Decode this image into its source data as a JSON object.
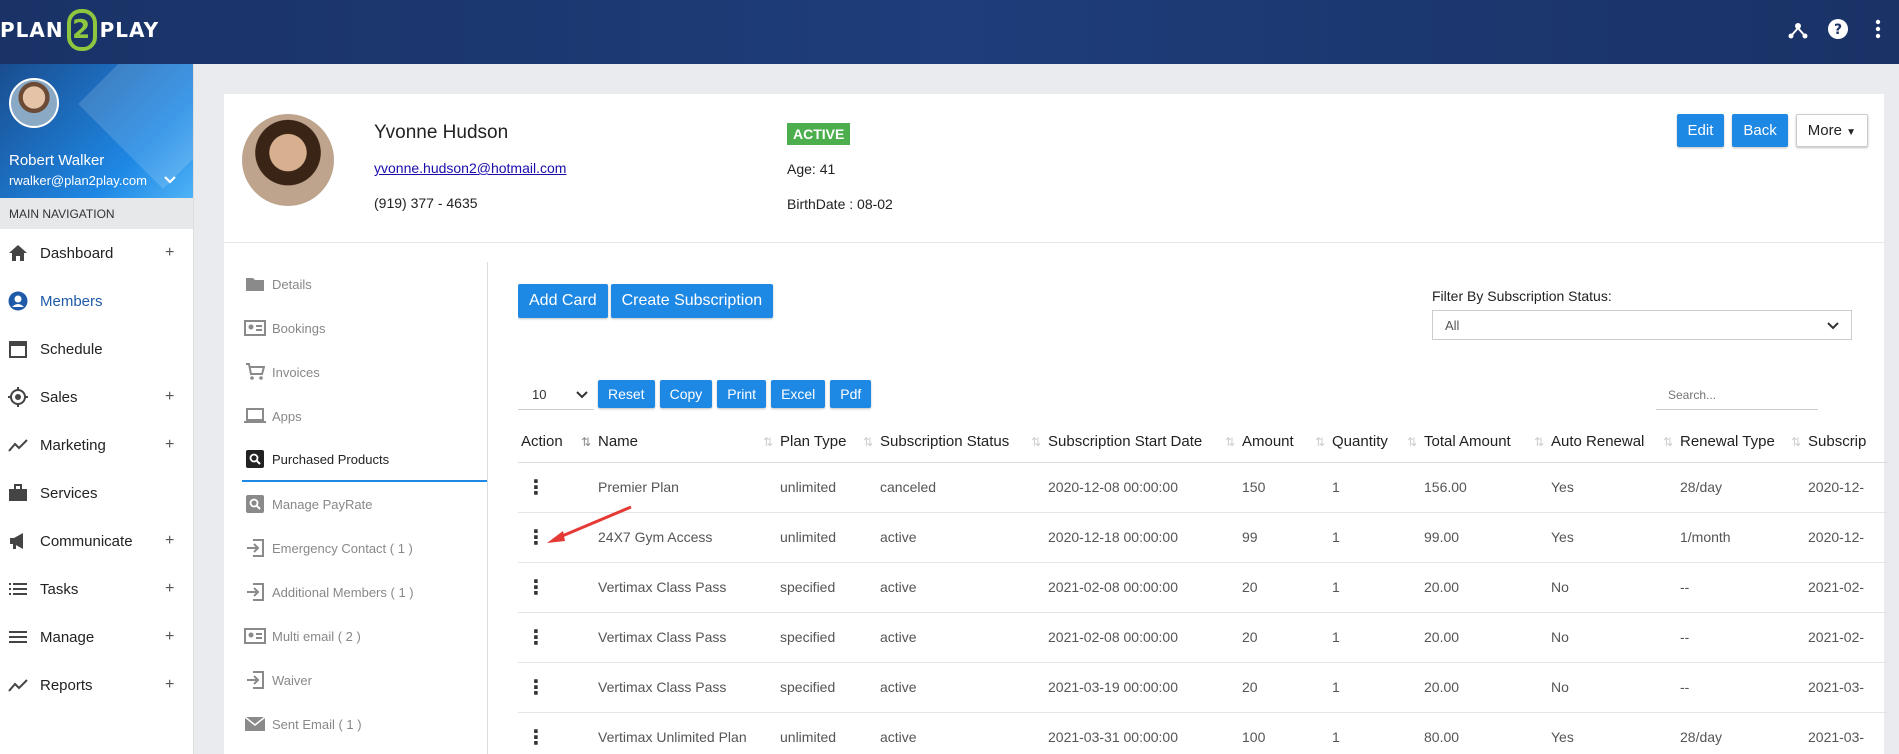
{
  "topbar": {
    "logo_left": "PLAN",
    "logo_mid": "2",
    "logo_right": "PLAY",
    "icons": [
      "network-icon",
      "help-icon",
      "more-vertical-icon"
    ]
  },
  "user": {
    "name": "Robert Walker",
    "email": "rwalker@plan2play.com"
  },
  "nav": {
    "heading": "MAIN NAVIGATION",
    "items": [
      {
        "label": "Dashboard",
        "icon": "home-icon",
        "expandable": true
      },
      {
        "label": "Members",
        "icon": "user-icon",
        "expandable": false,
        "active": true
      },
      {
        "label": "Schedule",
        "icon": "calendar-icon",
        "expandable": false
      },
      {
        "label": "Sales",
        "icon": "target-icon",
        "expandable": true
      },
      {
        "label": "Marketing",
        "icon": "trend-icon",
        "expandable": true
      },
      {
        "label": "Services",
        "icon": "briefcase-icon",
        "expandable": false
      },
      {
        "label": "Communicate",
        "icon": "megaphone-icon",
        "expandable": true
      },
      {
        "label": "Tasks",
        "icon": "list-icon",
        "expandable": true
      },
      {
        "label": "Manage",
        "icon": "menu-icon",
        "expandable": true
      },
      {
        "label": "Reports",
        "icon": "chart-icon",
        "expandable": true
      }
    ]
  },
  "member": {
    "name": "Yvonne Hudson",
    "email": "yvonne.hudson2@hotmail.com",
    "phone": "(919) 377 - 4635",
    "status": "ACTIVE",
    "age": "Age: 41",
    "birthdate": "BirthDate : 08-02"
  },
  "header_buttons": {
    "edit": "Edit",
    "back": "Back",
    "more": "More"
  },
  "submenu": [
    {
      "label": "Details",
      "icon": "folder-icon"
    },
    {
      "label": "Bookings",
      "icon": "id-card-icon"
    },
    {
      "label": "Invoices",
      "icon": "cart-icon"
    },
    {
      "label": "Apps",
      "icon": "laptop-icon"
    },
    {
      "label": "Purchased Products",
      "icon": "search-box-icon",
      "active": true
    },
    {
      "label": "Manage PayRate",
      "icon": "search-box-icon"
    },
    {
      "label": "Emergency Contact ( 1 )",
      "icon": "sign-in-icon"
    },
    {
      "label": "Additional Members ( 1 )",
      "icon": "sign-in-icon"
    },
    {
      "label": "Multi email ( 2 )",
      "icon": "id-card-icon"
    },
    {
      "label": "Waiver",
      "icon": "sign-in-icon"
    },
    {
      "label": "Sent Email ( 1 )",
      "icon": "envelope-icon"
    }
  ],
  "actions": {
    "add_card": "Add Card",
    "create_subscription": "Create Subscription"
  },
  "filter": {
    "label": "Filter By Subscription Status:",
    "selected": "All"
  },
  "table_controls": {
    "page_length": "10",
    "buttons": [
      "Reset",
      "Copy",
      "Print",
      "Excel",
      "Pdf"
    ],
    "search_placeholder": "Search..."
  },
  "table": {
    "headers": [
      "Action",
      "Name",
      "Plan Type",
      "Subscription Status",
      "Subscription Start Date",
      "Amount",
      "Quantity",
      "Total Amount",
      "Auto Renewal",
      "Renewal Type",
      "Subscrip"
    ],
    "rows": [
      [
        "⋮",
        "Premier Plan",
        "unlimited",
        "canceled",
        "2020-12-08 00:00:00",
        "150",
        "1",
        "156.00",
        "Yes",
        "28/day",
        "2020-12-"
      ],
      [
        "⋮",
        "24X7 Gym Access",
        "unlimited",
        "active",
        "2020-12-18 00:00:00",
        "99",
        "1",
        "99.00",
        "Yes",
        "1/month",
        "2020-12-"
      ],
      [
        "⋮",
        "Vertimax Class Pass",
        "specified",
        "active",
        "2021-02-08 00:00:00",
        "20",
        "1",
        "20.00",
        "No",
        "--",
        "2021-02-"
      ],
      [
        "⋮",
        "Vertimax Class Pass",
        "specified",
        "active",
        "2021-02-08 00:00:00",
        "20",
        "1",
        "20.00",
        "No",
        "--",
        "2021-02-"
      ],
      [
        "⋮",
        "Vertimax Class Pass",
        "specified",
        "active",
        "2021-03-19 00:00:00",
        "20",
        "1",
        "20.00",
        "No",
        "--",
        "2021-03-"
      ],
      [
        "⋮",
        "Vertimax Unlimited Plan",
        "unlimited",
        "active",
        "2021-03-31 00:00:00",
        "100",
        "1",
        "80.00",
        "Yes",
        "28/day",
        "2021-03-"
      ]
    ]
  },
  "colors": {
    "primary": "#1e88e5",
    "topbar": "#1a3266",
    "active_badge": "#4cae4c",
    "annotation_arrow": "#e53935"
  }
}
